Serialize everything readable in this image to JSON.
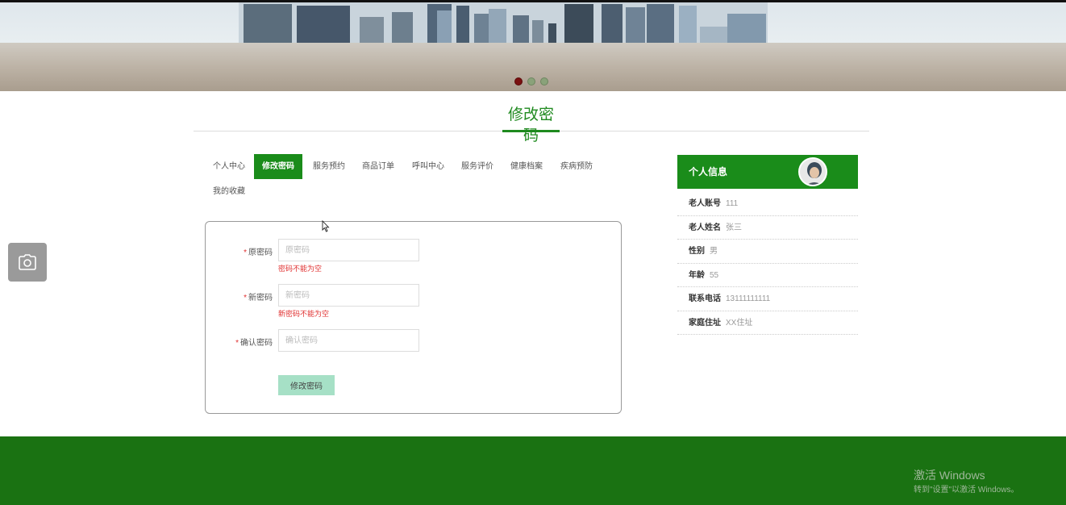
{
  "banner": {
    "slide_count": 3,
    "active_slide": 1
  },
  "page": {
    "title": "修改密码"
  },
  "tabs": [
    {
      "label": "个人中心",
      "active": false
    },
    {
      "label": "修改密码",
      "active": true
    },
    {
      "label": "服务预约",
      "active": false
    },
    {
      "label": "商品订单",
      "active": false
    },
    {
      "label": "呼叫中心",
      "active": false
    },
    {
      "label": "服务评价",
      "active": false
    },
    {
      "label": "健康档案",
      "active": false
    },
    {
      "label": "疾病预防",
      "active": false
    },
    {
      "label": "我的收藏",
      "active": false
    }
  ],
  "form": {
    "required_mark": "*",
    "old_password": {
      "label": "原密码",
      "placeholder": "原密码",
      "value": "",
      "error": "密码不能为空"
    },
    "new_password": {
      "label": "新密码",
      "placeholder": "新密码",
      "value": "",
      "error": "新密码不能为空"
    },
    "confirm_password": {
      "label": "确认密码",
      "placeholder": "确认密码",
      "value": ""
    },
    "submit_label": "修改密码"
  },
  "sidebar": {
    "title": "个人信息",
    "rows": [
      {
        "key": "老人账号",
        "value": "111"
      },
      {
        "key": "老人姓名",
        "value": "张三"
      },
      {
        "key": "性别",
        "value": "男"
      },
      {
        "key": "年龄",
        "value": "55"
      },
      {
        "key": "联系电话",
        "value": "13111111111"
      },
      {
        "key": "家庭住址",
        "value": "XX住址"
      }
    ]
  },
  "watermark": {
    "line1": "激活 Windows",
    "line2": "转到\"设置\"以激活 Windows。"
  },
  "colors": {
    "primary_green": "#1a8c1a",
    "footer_green": "#1a7212",
    "error_red": "#e03030",
    "button_mint": "#a6e0c6"
  }
}
